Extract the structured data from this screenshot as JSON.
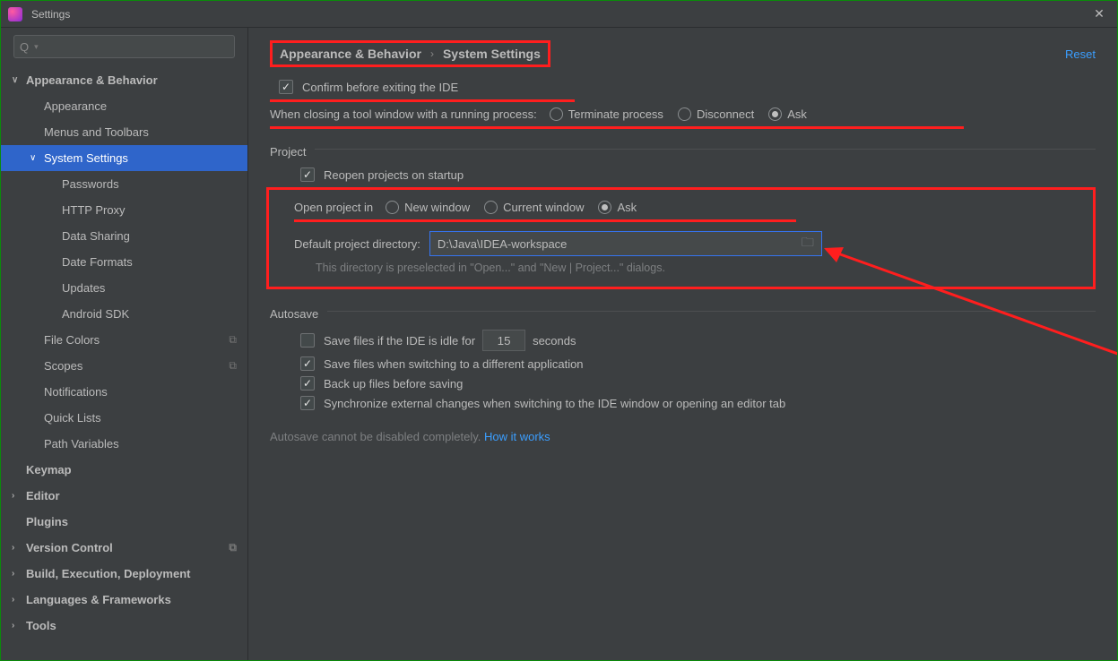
{
  "window": {
    "title": "Settings"
  },
  "breadcrumb": {
    "group": "Appearance & Behavior",
    "page": "System Settings",
    "reset": "Reset"
  },
  "sidebar": {
    "items": [
      {
        "label": "Appearance & Behavior",
        "level": 1,
        "bold": true,
        "arrow": "∨"
      },
      {
        "label": "Appearance",
        "level": 2
      },
      {
        "label": "Menus and Toolbars",
        "level": 2
      },
      {
        "label": "System Settings",
        "level": 2,
        "arrow": "∨",
        "selected": true
      },
      {
        "label": "Passwords",
        "level": 3
      },
      {
        "label": "HTTP Proxy",
        "level": 3
      },
      {
        "label": "Data Sharing",
        "level": 3
      },
      {
        "label": "Date Formats",
        "level": 3
      },
      {
        "label": "Updates",
        "level": 3
      },
      {
        "label": "Android SDK",
        "level": 3
      },
      {
        "label": "File Colors",
        "level": 2,
        "trail": true
      },
      {
        "label": "Scopes",
        "level": 2,
        "trail": true
      },
      {
        "label": "Notifications",
        "level": 2
      },
      {
        "label": "Quick Lists",
        "level": 2
      },
      {
        "label": "Path Variables",
        "level": 2
      },
      {
        "label": "Keymap",
        "level": 1,
        "bold": true
      },
      {
        "label": "Editor",
        "level": 1,
        "bold": true,
        "arrow": ">"
      },
      {
        "label": "Plugins",
        "level": 1,
        "bold": true
      },
      {
        "label": "Version Control",
        "level": 1,
        "bold": true,
        "arrow": ">",
        "trail": true
      },
      {
        "label": "Build, Execution, Deployment",
        "level": 1,
        "bold": true,
        "arrow": ">"
      },
      {
        "label": "Languages & Frameworks",
        "level": 1,
        "bold": true,
        "arrow": ">"
      },
      {
        "label": "Tools",
        "level": 1,
        "bold": true,
        "arrow": ">"
      }
    ]
  },
  "main": {
    "confirm_exit": "Confirm before exiting the IDE",
    "closing_label": "When closing a tool window with a running process:",
    "closing_options": {
      "terminate": "Terminate process",
      "disconnect": "Disconnect",
      "ask": "Ask"
    },
    "project_header": "Project",
    "reopen": "Reopen projects on startup",
    "open_in_label": "Open project in",
    "open_in_options": {
      "new": "New window",
      "current": "Current window",
      "ask": "Ask"
    },
    "default_dir_label": "Default project directory:",
    "default_dir_value": "D:\\Java\\IDEA-workspace",
    "default_dir_hint": "This directory is preselected in \"Open...\" and \"New | Project...\" dialogs.",
    "autosave_header": "Autosave",
    "save_idle_prefix": "Save files if the IDE is idle for",
    "save_idle_value": "15",
    "save_idle_suffix": "seconds",
    "save_switch_app": "Save files when switching to a different application",
    "backup": "Back up files before saving",
    "sync_external": "Synchronize external changes when switching to the IDE window or opening an editor tab",
    "autosave_note_prefix": "Autosave cannot be disabled completely.",
    "autosave_note_link": "How it works"
  }
}
